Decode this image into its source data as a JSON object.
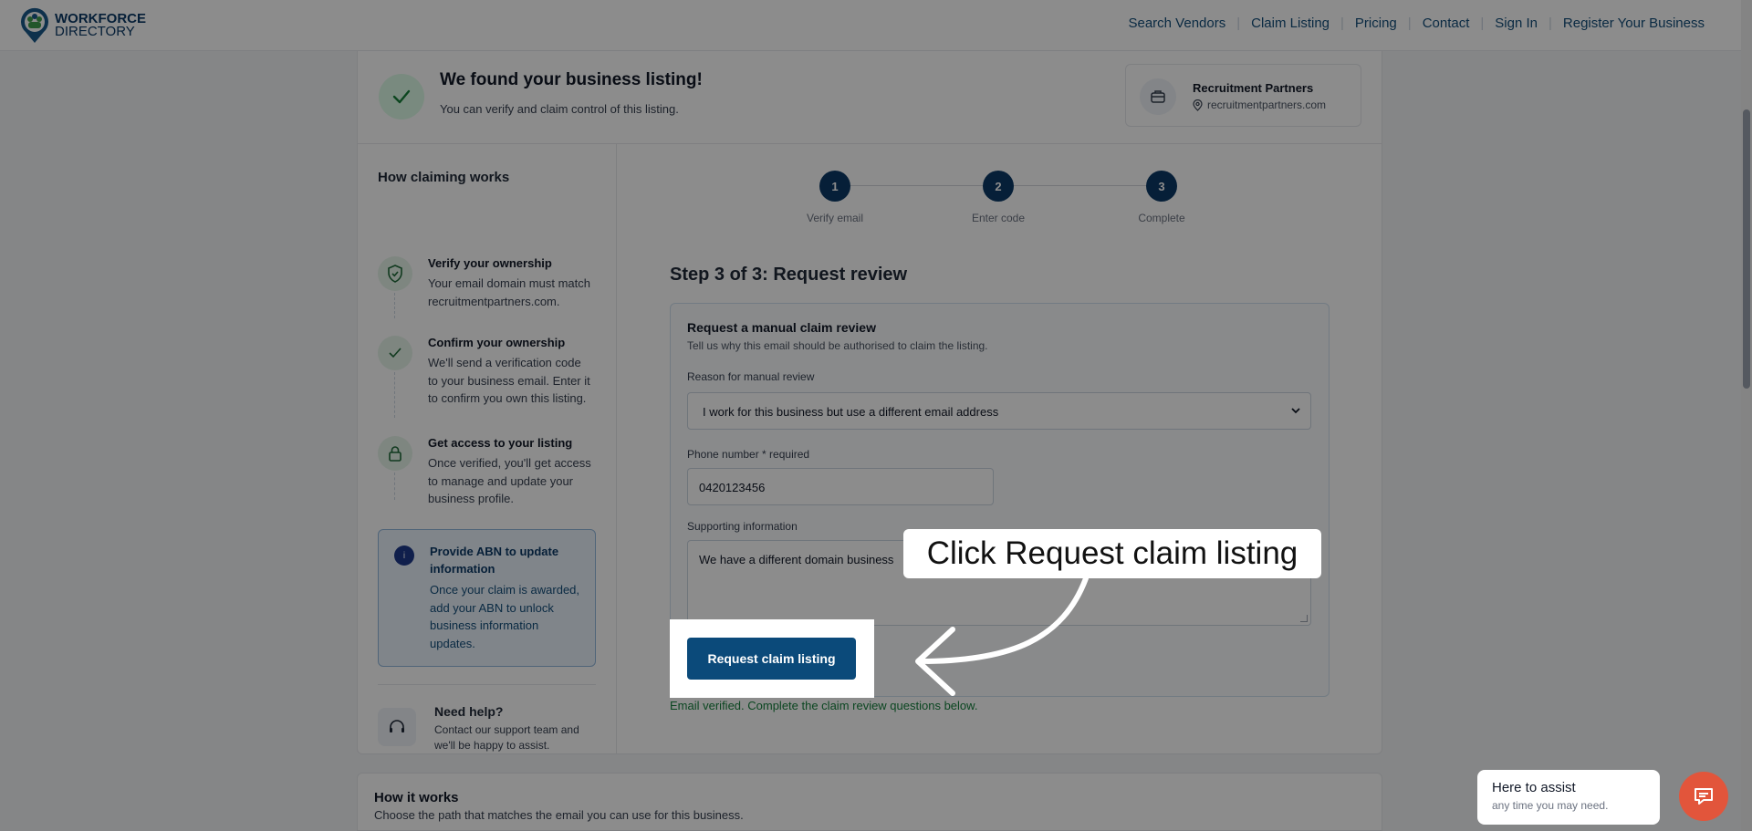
{
  "header": {
    "logo_line1": "WORKFORCE",
    "logo_line2": "DIRECTORY",
    "nav": [
      "Search Vendors",
      "Claim Listing",
      "Pricing",
      "Contact",
      "Sign In",
      "Register Your Business"
    ]
  },
  "found": {
    "title": "We found your business listing!",
    "subtitle": "You can verify and claim control of this listing.",
    "business_name": "Recruitment Partners",
    "business_domain": "recruitmentpartners.com"
  },
  "sidebar": {
    "heading": "How claiming works",
    "steps": [
      {
        "title": "Verify your ownership",
        "desc": "Your email domain must match recruitmentpartners.com.",
        "icon": "shield-check-icon"
      },
      {
        "title": "Confirm your ownership",
        "desc": "We'll send a verification code to your business email. Enter it to confirm you own this listing.",
        "icon": "check-icon"
      },
      {
        "title": "Get access to your listing",
        "desc": "Once verified, you'll get access to manage and update your business profile.",
        "icon": "lock-icon"
      }
    ],
    "abn_title": "Provide ABN to update information",
    "abn_desc": "Once your claim is awarded, add your ABN to unlock business information updates.",
    "help_title": "Need help?",
    "help_desc": "Contact our support team and we'll be happy to assist."
  },
  "stepper": [
    {
      "num": "1",
      "label": "Verify email"
    },
    {
      "num": "2",
      "label": "Enter code"
    },
    {
      "num": "3",
      "label": "Complete"
    }
  ],
  "main": {
    "title": "Step 3 of 3: Request review",
    "form_title": "Request a manual claim review",
    "form_subtitle": "Tell us why this email should be authorised to claim the listing.",
    "reason_label": "Reason for manual review",
    "reason_value": "I work for this business but use a different email address",
    "phone_label": "Phone number * required",
    "phone_value": "0420123456",
    "support_label": "Supporting information",
    "support_value": "We have a different domain business",
    "submit_label": "Request claim listing",
    "status_msg": "Email verified. Complete the claim review questions below."
  },
  "callout": {
    "text": "Click Request claim listing"
  },
  "below": {
    "title": "How it works",
    "subtitle": "Choose the path that matches the email you can use for this business."
  },
  "chat": {
    "title": "Here to assist",
    "subtitle": "any time you may need."
  },
  "colors": {
    "brand": "#0b3a66",
    "accent": "#e2553b",
    "success": "#15803d"
  }
}
